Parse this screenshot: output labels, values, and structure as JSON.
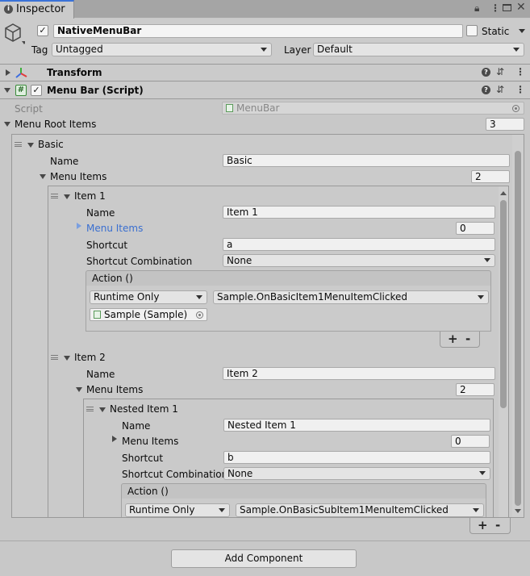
{
  "window": {
    "tab_label": "Inspector",
    "lock_icon": "lock-icon",
    "menu_icon": "kebab-menu-icon",
    "maximize_icon": "maximize-icon",
    "close_icon": "close-icon"
  },
  "header": {
    "object_name": "NativeMenuBar",
    "static_label": "Static",
    "tag_label": "Tag",
    "tag_value": "Untagged",
    "layer_label": "Layer",
    "layer_value": "Default"
  },
  "components": {
    "transform_label": "Transform",
    "menubar_label": "Menu Bar (Script)"
  },
  "script_row": {
    "label": "Script",
    "value": "MenuBar"
  },
  "root": {
    "label": "Menu Root Items",
    "count": "3"
  },
  "basic": {
    "label": "Basic",
    "name_label": "Name",
    "name_value": "Basic",
    "menu_items_label": "Menu Items",
    "menu_items_count": "2"
  },
  "item1": {
    "label": "Item 1",
    "name_label": "Name",
    "name_value": "Item 1",
    "menu_items_label": "Menu Items",
    "menu_items_count": "0",
    "shortcut_label": "Shortcut",
    "shortcut_value": "a",
    "combo_label": "Shortcut Combination",
    "combo_value": "None",
    "action_label": "Action ()",
    "runtime_value": "Runtime Only",
    "method_value": "Sample.OnBasicItem1MenuItemClicked",
    "target_value": "Sample (Sample)"
  },
  "item2": {
    "label": "Item 2",
    "name_label": "Name",
    "name_value": "Item 2",
    "menu_items_label": "Menu Items",
    "menu_items_count": "2"
  },
  "nested1": {
    "label": "Nested Item 1",
    "name_label": "Name",
    "name_value": "Nested Item 1",
    "menu_items_label": "Menu Items",
    "menu_items_count": "0",
    "shortcut_label": "Shortcut",
    "shortcut_value": "b",
    "combo_label": "Shortcut Combination",
    "combo_value": "None",
    "action_label": "Action ()",
    "runtime_value": "Runtime Only",
    "method_value": "Sample.OnBasicSubItem1MenuItemClicked"
  },
  "list_buttons": {
    "plus": "+",
    "minus": "-"
  },
  "footer": {
    "add_component_label": "Add Component"
  }
}
